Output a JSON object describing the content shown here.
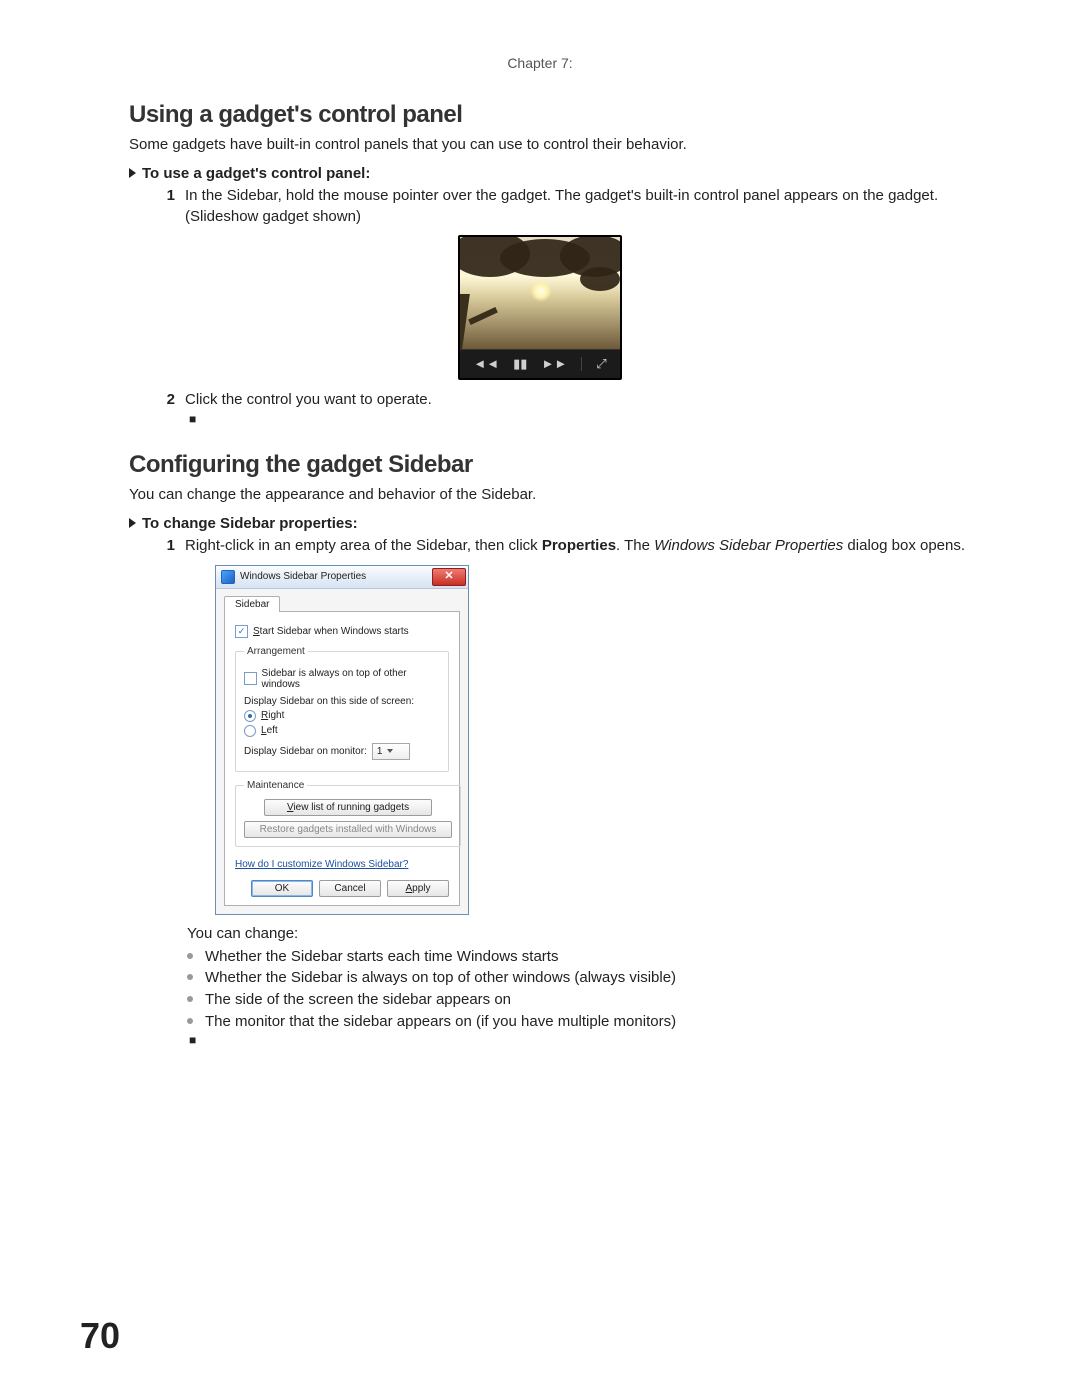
{
  "header": {
    "chapter": "Chapter 7:"
  },
  "page_number": "70",
  "section1": {
    "title": "Using a gadget's control panel",
    "intro": "Some gadgets have built-in control panels that you can use to control their behavior.",
    "subhead": "To use a gadget's control panel:",
    "steps": {
      "s1_num": "1",
      "s1": "In the Sidebar, hold the mouse pointer over the gadget. The gadget's built-in control panel appears on the gadget. (Slideshow gadget shown)",
      "s2_num": "2",
      "s2": "Click the control you want to operate."
    }
  },
  "slideshow": {
    "prev_icon": "◄◄",
    "pause_icon": "▮▮",
    "next_icon": "►►",
    "view_icon": "⤢"
  },
  "section2": {
    "title": "Configuring the gadget Sidebar",
    "intro": "You can change the appearance and behavior of the Sidebar.",
    "subhead": "To change Sidebar properties:",
    "steps": {
      "s1_num": "1",
      "s1_pre": "Right-click in an empty area of the Sidebar, then click ",
      "s1_bold": "Properties",
      "s1_mid": ". The ",
      "s1_ital": "Windows Sidebar Properties",
      "s1_post": " dialog box opens."
    },
    "after": "You can change:",
    "bullets": {
      "b1": "Whether the Sidebar starts each time Windows starts",
      "b2": "Whether the Sidebar is always on top of other windows (always visible)",
      "b3": "The side of the screen the sidebar appears on",
      "b4": "The monitor that the sidebar appears on (if you have multiple monitors)"
    }
  },
  "dialog": {
    "title": "Windows Sidebar Properties",
    "tab": "Sidebar",
    "start_label_pre": "S",
    "start_label": "tart Sidebar when Windows starts",
    "group_arrangement": "Arrangement",
    "on_top": "Sidebar is always on top of other windows",
    "side_label": "Display Sidebar on this side of screen:",
    "right_pre": "R",
    "right": "ight",
    "left_pre": "L",
    "left": "eft",
    "monitor_label": "Display Sidebar on monitor:",
    "monitor_value": "1",
    "group_maintenance": "Maintenance",
    "btn_viewlist_pre": "V",
    "btn_viewlist": "iew list of running gadgets",
    "btn_restore": "Restore gadgets installed with Windows",
    "help_link": "How do I customize Windows Sidebar?",
    "btn_ok": "OK",
    "btn_cancel": "Cancel",
    "btn_apply_pre": "A",
    "btn_apply": "pply"
  }
}
